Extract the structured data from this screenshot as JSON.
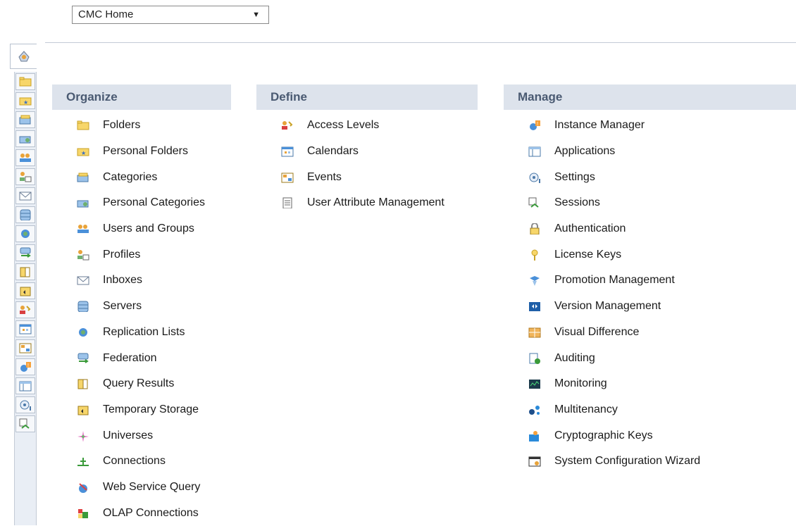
{
  "top_select": {
    "value": "CMC Home"
  },
  "rail": {
    "icons": [
      "folder-icon",
      "star-folder-icon",
      "categories-icon",
      "personal-categories-icon",
      "users-groups-icon",
      "profiles-icon",
      "inbox-icon",
      "servers-icon",
      "replication-icon",
      "federation-icon",
      "query-results-icon",
      "temporary-storage-icon",
      "access-levels-icon",
      "calendar-icon",
      "events-icon",
      "instance-manager-icon",
      "applications-icon",
      "settings-icon",
      "sessions-icon"
    ]
  },
  "columns": {
    "organize": {
      "title": "Organize",
      "items": [
        {
          "label": "Folders",
          "icon": "folder-icon"
        },
        {
          "label": "Personal Folders",
          "icon": "star-folder-icon"
        },
        {
          "label": "Categories",
          "icon": "categories-icon"
        },
        {
          "label": "Personal Categories",
          "icon": "personal-categories-icon"
        },
        {
          "label": "Users and Groups",
          "icon": "users-groups-icon"
        },
        {
          "label": "Profiles",
          "icon": "profiles-icon"
        },
        {
          "label": "Inboxes",
          "icon": "inbox-icon"
        },
        {
          "label": "Servers",
          "icon": "servers-icon"
        },
        {
          "label": "Replication Lists",
          "icon": "replication-icon"
        },
        {
          "label": "Federation",
          "icon": "federation-icon"
        },
        {
          "label": "Query Results",
          "icon": "query-results-icon"
        },
        {
          "label": "Temporary Storage",
          "icon": "temporary-storage-icon"
        },
        {
          "label": "Universes",
          "icon": "universes-icon"
        },
        {
          "label": "Connections",
          "icon": "connections-icon"
        },
        {
          "label": "Web Service Query",
          "icon": "web-service-icon"
        },
        {
          "label": "OLAP Connections",
          "icon": "olap-icon"
        }
      ]
    },
    "define": {
      "title": "Define",
      "items": [
        {
          "label": "Access Levels",
          "icon": "access-levels-icon"
        },
        {
          "label": "Calendars",
          "icon": "calendar-icon"
        },
        {
          "label": "Events",
          "icon": "events-icon"
        },
        {
          "label": "User Attribute Management",
          "icon": "user-attribute-icon"
        }
      ]
    },
    "manage": {
      "title": "Manage",
      "items": [
        {
          "label": "Instance Manager",
          "icon": "instance-manager-icon"
        },
        {
          "label": "Applications",
          "icon": "applications-icon"
        },
        {
          "label": "Settings",
          "icon": "settings-icon"
        },
        {
          "label": "Sessions",
          "icon": "sessions-icon"
        },
        {
          "label": "Authentication",
          "icon": "lock-icon"
        },
        {
          "label": "License Keys",
          "icon": "key-icon"
        },
        {
          "label": "Promotion Management",
          "icon": "promotion-icon"
        },
        {
          "label": "Version Management",
          "icon": "version-icon"
        },
        {
          "label": "Visual Difference",
          "icon": "visual-difference-icon"
        },
        {
          "label": "Auditing",
          "icon": "auditing-icon"
        },
        {
          "label": "Monitoring",
          "icon": "monitoring-icon"
        },
        {
          "label": "Multitenancy",
          "icon": "multitenancy-icon"
        },
        {
          "label": "Cryptographic Keys",
          "icon": "crypto-keys-icon"
        },
        {
          "label": "System Configuration Wizard",
          "icon": "config-wizard-icon"
        }
      ]
    }
  }
}
